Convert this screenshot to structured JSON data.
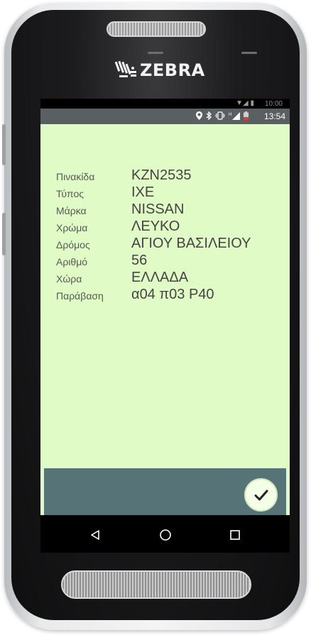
{
  "device": {
    "brand": "ZEBRA"
  },
  "ghost_status": {
    "time": "10:00"
  },
  "status_bar": {
    "time": "13:54",
    "icons": [
      "location-icon",
      "bluetooth-icon",
      "vibrate-icon",
      "signal-icon",
      "battery-low-icon"
    ],
    "battery_color": "#e53935"
  },
  "record": {
    "fields": [
      {
        "label": "Πινακίδα",
        "value": "KZN2535"
      },
      {
        "label": "Τύπος",
        "value": "IXE"
      },
      {
        "label": "Μάρκα",
        "value": "NISSAN"
      },
      {
        "label": "Χρώμα",
        "value": "ΛΕΥΚΟ"
      },
      {
        "label": "Δρόμος",
        "value": "ΑΓΙΟΥ ΒΑΣΙΛΕΙΟΥ"
      },
      {
        "label": "Αριθμό",
        "value": "56"
      },
      {
        "label": "Χώρα",
        "value": "ΕΛΛΑΔΑ"
      },
      {
        "label": "Παράβαση",
        "value": "α04 π03 Ρ40"
      }
    ]
  },
  "actions": {
    "confirm_icon": "checkmark-icon"
  },
  "navigation": {
    "buttons": [
      "back-icon",
      "home-icon",
      "recents-icon"
    ]
  },
  "colors": {
    "app_background": "#e1fbc6",
    "bottom_panel": "#567477",
    "status_bar": "#5a5f62"
  }
}
